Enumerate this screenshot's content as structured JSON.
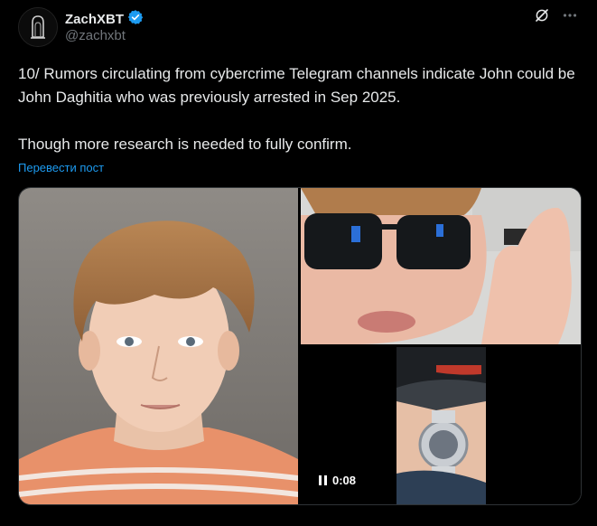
{
  "author": {
    "display_name": "ZachXBT",
    "handle": "@zachxbt",
    "verified": true,
    "verified_color": "#1d9bf0"
  },
  "tweet": {
    "text": "10/ Rumors circulating from cybercrime Telegram channels indicate John could be John Daghitia who was previously arrested in Sep 2025.\n\nThough more research is needed to fully confirm.",
    "translate_label": "Перевести пост"
  },
  "media": {
    "video_duration": "0:08",
    "items": [
      {
        "kind": "photo",
        "icon": "mugshot-photo"
      },
      {
        "kind": "photo",
        "icon": "sunglasses-selfie-photo"
      },
      {
        "kind": "video",
        "icon": "wristwatch-video"
      }
    ]
  },
  "icons": {
    "grok": "grok-icon",
    "more": "more-icon"
  },
  "colors": {
    "background": "#000000",
    "text": "#e7e9ea",
    "muted": "#71767b",
    "link": "#1d9bf0"
  }
}
